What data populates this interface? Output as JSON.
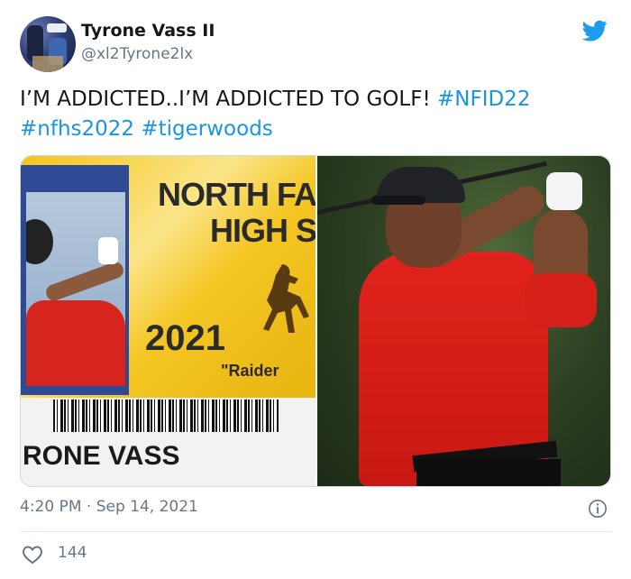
{
  "author": {
    "name": "Tyrone Vass II",
    "handle": "@xl2Tyrone2lx",
    "avatar_icon": "user-avatar"
  },
  "brand": {
    "icon": "twitter-bird-icon",
    "color": "#1d9bf0"
  },
  "tweet": {
    "text_plain": "I’M ADDICTED..I’M ADDICTED TO GOLF! ",
    "hashtags": [
      "#NFID22",
      "#nfhs2022",
      "#tigerwoods"
    ],
    "hashtag_color": "#1b95e0"
  },
  "media": {
    "id_card": {
      "school_line1": "NORTH FAR",
      "school_line2": "HIGH SC",
      "year": "2021",
      "mascot": "\"Raider",
      "name": "RONE VASS"
    }
  },
  "footer": {
    "timestamp": "4:20 PM · Sep 14, 2021",
    "info_icon": "info-icon",
    "likes": "144",
    "like_icon": "heart-icon"
  }
}
